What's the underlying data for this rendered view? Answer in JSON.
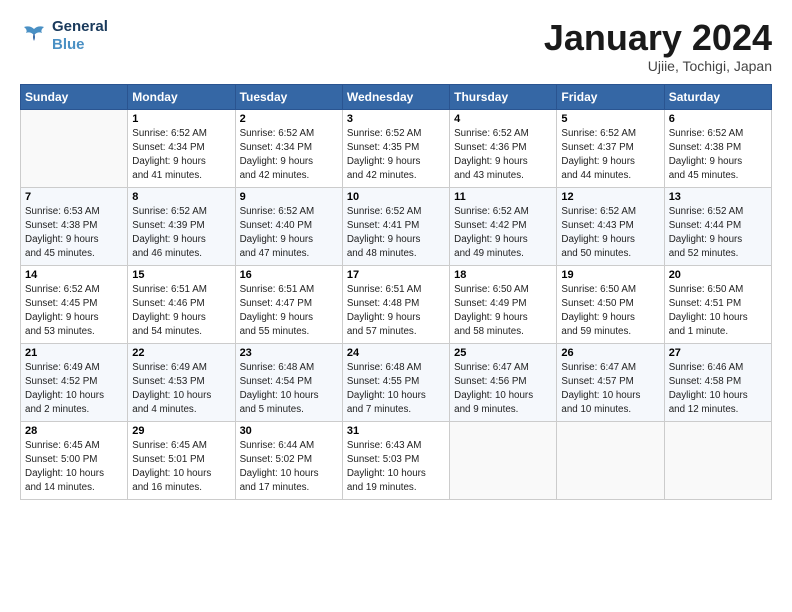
{
  "header": {
    "logo_line1": "General",
    "logo_line2": "Blue",
    "month_title": "January 2024",
    "location": "Ujiie, Tochigi, Japan"
  },
  "weekdays": [
    "Sunday",
    "Monday",
    "Tuesday",
    "Wednesday",
    "Thursday",
    "Friday",
    "Saturday"
  ],
  "weeks": [
    [
      {
        "day": "",
        "info": ""
      },
      {
        "day": "1",
        "info": "Sunrise: 6:52 AM\nSunset: 4:34 PM\nDaylight: 9 hours\nand 41 minutes."
      },
      {
        "day": "2",
        "info": "Sunrise: 6:52 AM\nSunset: 4:34 PM\nDaylight: 9 hours\nand 42 minutes."
      },
      {
        "day": "3",
        "info": "Sunrise: 6:52 AM\nSunset: 4:35 PM\nDaylight: 9 hours\nand 42 minutes."
      },
      {
        "day": "4",
        "info": "Sunrise: 6:52 AM\nSunset: 4:36 PM\nDaylight: 9 hours\nand 43 minutes."
      },
      {
        "day": "5",
        "info": "Sunrise: 6:52 AM\nSunset: 4:37 PM\nDaylight: 9 hours\nand 44 minutes."
      },
      {
        "day": "6",
        "info": "Sunrise: 6:52 AM\nSunset: 4:38 PM\nDaylight: 9 hours\nand 45 minutes."
      }
    ],
    [
      {
        "day": "7",
        "info": "Sunrise: 6:53 AM\nSunset: 4:38 PM\nDaylight: 9 hours\nand 45 minutes."
      },
      {
        "day": "8",
        "info": "Sunrise: 6:52 AM\nSunset: 4:39 PM\nDaylight: 9 hours\nand 46 minutes."
      },
      {
        "day": "9",
        "info": "Sunrise: 6:52 AM\nSunset: 4:40 PM\nDaylight: 9 hours\nand 47 minutes."
      },
      {
        "day": "10",
        "info": "Sunrise: 6:52 AM\nSunset: 4:41 PM\nDaylight: 9 hours\nand 48 minutes."
      },
      {
        "day": "11",
        "info": "Sunrise: 6:52 AM\nSunset: 4:42 PM\nDaylight: 9 hours\nand 49 minutes."
      },
      {
        "day": "12",
        "info": "Sunrise: 6:52 AM\nSunset: 4:43 PM\nDaylight: 9 hours\nand 50 minutes."
      },
      {
        "day": "13",
        "info": "Sunrise: 6:52 AM\nSunset: 4:44 PM\nDaylight: 9 hours\nand 52 minutes."
      }
    ],
    [
      {
        "day": "14",
        "info": "Sunrise: 6:52 AM\nSunset: 4:45 PM\nDaylight: 9 hours\nand 53 minutes."
      },
      {
        "day": "15",
        "info": "Sunrise: 6:51 AM\nSunset: 4:46 PM\nDaylight: 9 hours\nand 54 minutes."
      },
      {
        "day": "16",
        "info": "Sunrise: 6:51 AM\nSunset: 4:47 PM\nDaylight: 9 hours\nand 55 minutes."
      },
      {
        "day": "17",
        "info": "Sunrise: 6:51 AM\nSunset: 4:48 PM\nDaylight: 9 hours\nand 57 minutes."
      },
      {
        "day": "18",
        "info": "Sunrise: 6:50 AM\nSunset: 4:49 PM\nDaylight: 9 hours\nand 58 minutes."
      },
      {
        "day": "19",
        "info": "Sunrise: 6:50 AM\nSunset: 4:50 PM\nDaylight: 9 hours\nand 59 minutes."
      },
      {
        "day": "20",
        "info": "Sunrise: 6:50 AM\nSunset: 4:51 PM\nDaylight: 10 hours\nand 1 minute."
      }
    ],
    [
      {
        "day": "21",
        "info": "Sunrise: 6:49 AM\nSunset: 4:52 PM\nDaylight: 10 hours\nand 2 minutes."
      },
      {
        "day": "22",
        "info": "Sunrise: 6:49 AM\nSunset: 4:53 PM\nDaylight: 10 hours\nand 4 minutes."
      },
      {
        "day": "23",
        "info": "Sunrise: 6:48 AM\nSunset: 4:54 PM\nDaylight: 10 hours\nand 5 minutes."
      },
      {
        "day": "24",
        "info": "Sunrise: 6:48 AM\nSunset: 4:55 PM\nDaylight: 10 hours\nand 7 minutes."
      },
      {
        "day": "25",
        "info": "Sunrise: 6:47 AM\nSunset: 4:56 PM\nDaylight: 10 hours\nand 9 minutes."
      },
      {
        "day": "26",
        "info": "Sunrise: 6:47 AM\nSunset: 4:57 PM\nDaylight: 10 hours\nand 10 minutes."
      },
      {
        "day": "27",
        "info": "Sunrise: 6:46 AM\nSunset: 4:58 PM\nDaylight: 10 hours\nand 12 minutes."
      }
    ],
    [
      {
        "day": "28",
        "info": "Sunrise: 6:45 AM\nSunset: 5:00 PM\nDaylight: 10 hours\nand 14 minutes."
      },
      {
        "day": "29",
        "info": "Sunrise: 6:45 AM\nSunset: 5:01 PM\nDaylight: 10 hours\nand 16 minutes."
      },
      {
        "day": "30",
        "info": "Sunrise: 6:44 AM\nSunset: 5:02 PM\nDaylight: 10 hours\nand 17 minutes."
      },
      {
        "day": "31",
        "info": "Sunrise: 6:43 AM\nSunset: 5:03 PM\nDaylight: 10 hours\nand 19 minutes."
      },
      {
        "day": "",
        "info": ""
      },
      {
        "day": "",
        "info": ""
      },
      {
        "day": "",
        "info": ""
      }
    ]
  ]
}
